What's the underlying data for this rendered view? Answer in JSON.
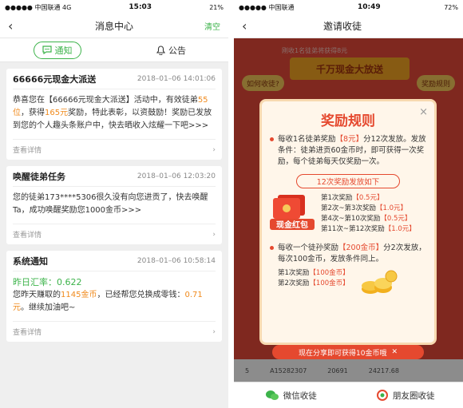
{
  "left": {
    "status": {
      "carrier": "●●●●● 中国联通  4G",
      "time": "15:03",
      "battery": "21%"
    },
    "nav": {
      "back": "‹",
      "title": "消息中心",
      "right": "清空"
    },
    "tabs": [
      {
        "label": "通知"
      },
      {
        "label": "公告"
      }
    ],
    "cards": [
      {
        "title": "66666元现金大派送",
        "time": "2018–01–06 14:01:06",
        "body_parts": [
          "恭喜您在【66666元现金大派送】活动中，有效徒弟",
          "55位",
          "，获得",
          "165元",
          "奖励，特此表彰，以资鼓励！奖励已发放到您的个人趣头条账户中，快去晒收入炫耀一下吧>>>"
        ],
        "more": "查看详情"
      },
      {
        "title": "唤醒徒弟任务",
        "time": "2018–01–06 12:03:20",
        "body": "您的徒弟173****5306很久没有向您进贡了，快去唤醒Ta，成功唤醒奖励您1000金币>>>",
        "more": "查看详情"
      },
      {
        "title": "系统通知",
        "time": "2018–01–06 10:58:14",
        "rate_label": "昨日汇率：0.622",
        "body_parts": [
          "您昨天赚取的",
          "1145金币",
          "，已经帮您兑换成零钱：",
          "0.71元",
          "。继续加油吧~"
        ],
        "more": "查看详情"
      }
    ]
  },
  "right": {
    "status": {
      "carrier": "●●●●● 中国联通",
      "time": "10:49",
      "battery": "72%"
    },
    "nav": {
      "back": "‹",
      "title": "邀请收徒"
    },
    "ticker": "刚收1名徒弟将获得8元",
    "banner": "千万现金大放送",
    "btn_left": "如何收徒?",
    "btn_right": "奖励规则",
    "modal": {
      "title": "奖励规则",
      "close": "×",
      "rule1_parts": [
        "每收1名徒弟奖励",
        "【8元】",
        "分12次发放。发放条件：徒弟进贡60金币时，即可获得一次奖励，每个徒弟每天仅奖励一次。"
      ],
      "pill": "12次奖励发放如下",
      "rewards": [
        {
          "label": "第1次奖励",
          "amount": "【0.5元】"
        },
        {
          "label": "第2次~第3次奖励",
          "amount": "【1.0元】"
        },
        {
          "label": "第4次~第10次奖励",
          "amount": "【0.5元】"
        },
        {
          "label": "第11次~第12次奖励",
          "amount": "【1.0元】"
        }
      ],
      "envelope_text": "现金红包",
      "rule2_parts": [
        "每收一个徒孙奖励",
        "【200金币】",
        "分2次发放，每次100金币，发放条件同上。"
      ],
      "coins": [
        {
          "label": "第1次奖励",
          "amount": "【100金币】"
        },
        {
          "label": "第2次奖励",
          "amount": "【100金币】"
        }
      ]
    },
    "tip": "现在分享即可获得10金币哦",
    "row": {
      "rank": "5",
      "id": "A15282307",
      "score": "20691",
      "amount": "24217.68"
    },
    "bottom": [
      {
        "label": "微信收徒"
      },
      {
        "label": "朋友圈收徒"
      }
    ],
    "colors": {
      "green": "#3cb34a",
      "red": "#e5492f",
      "orange": "#f08a1c"
    }
  }
}
